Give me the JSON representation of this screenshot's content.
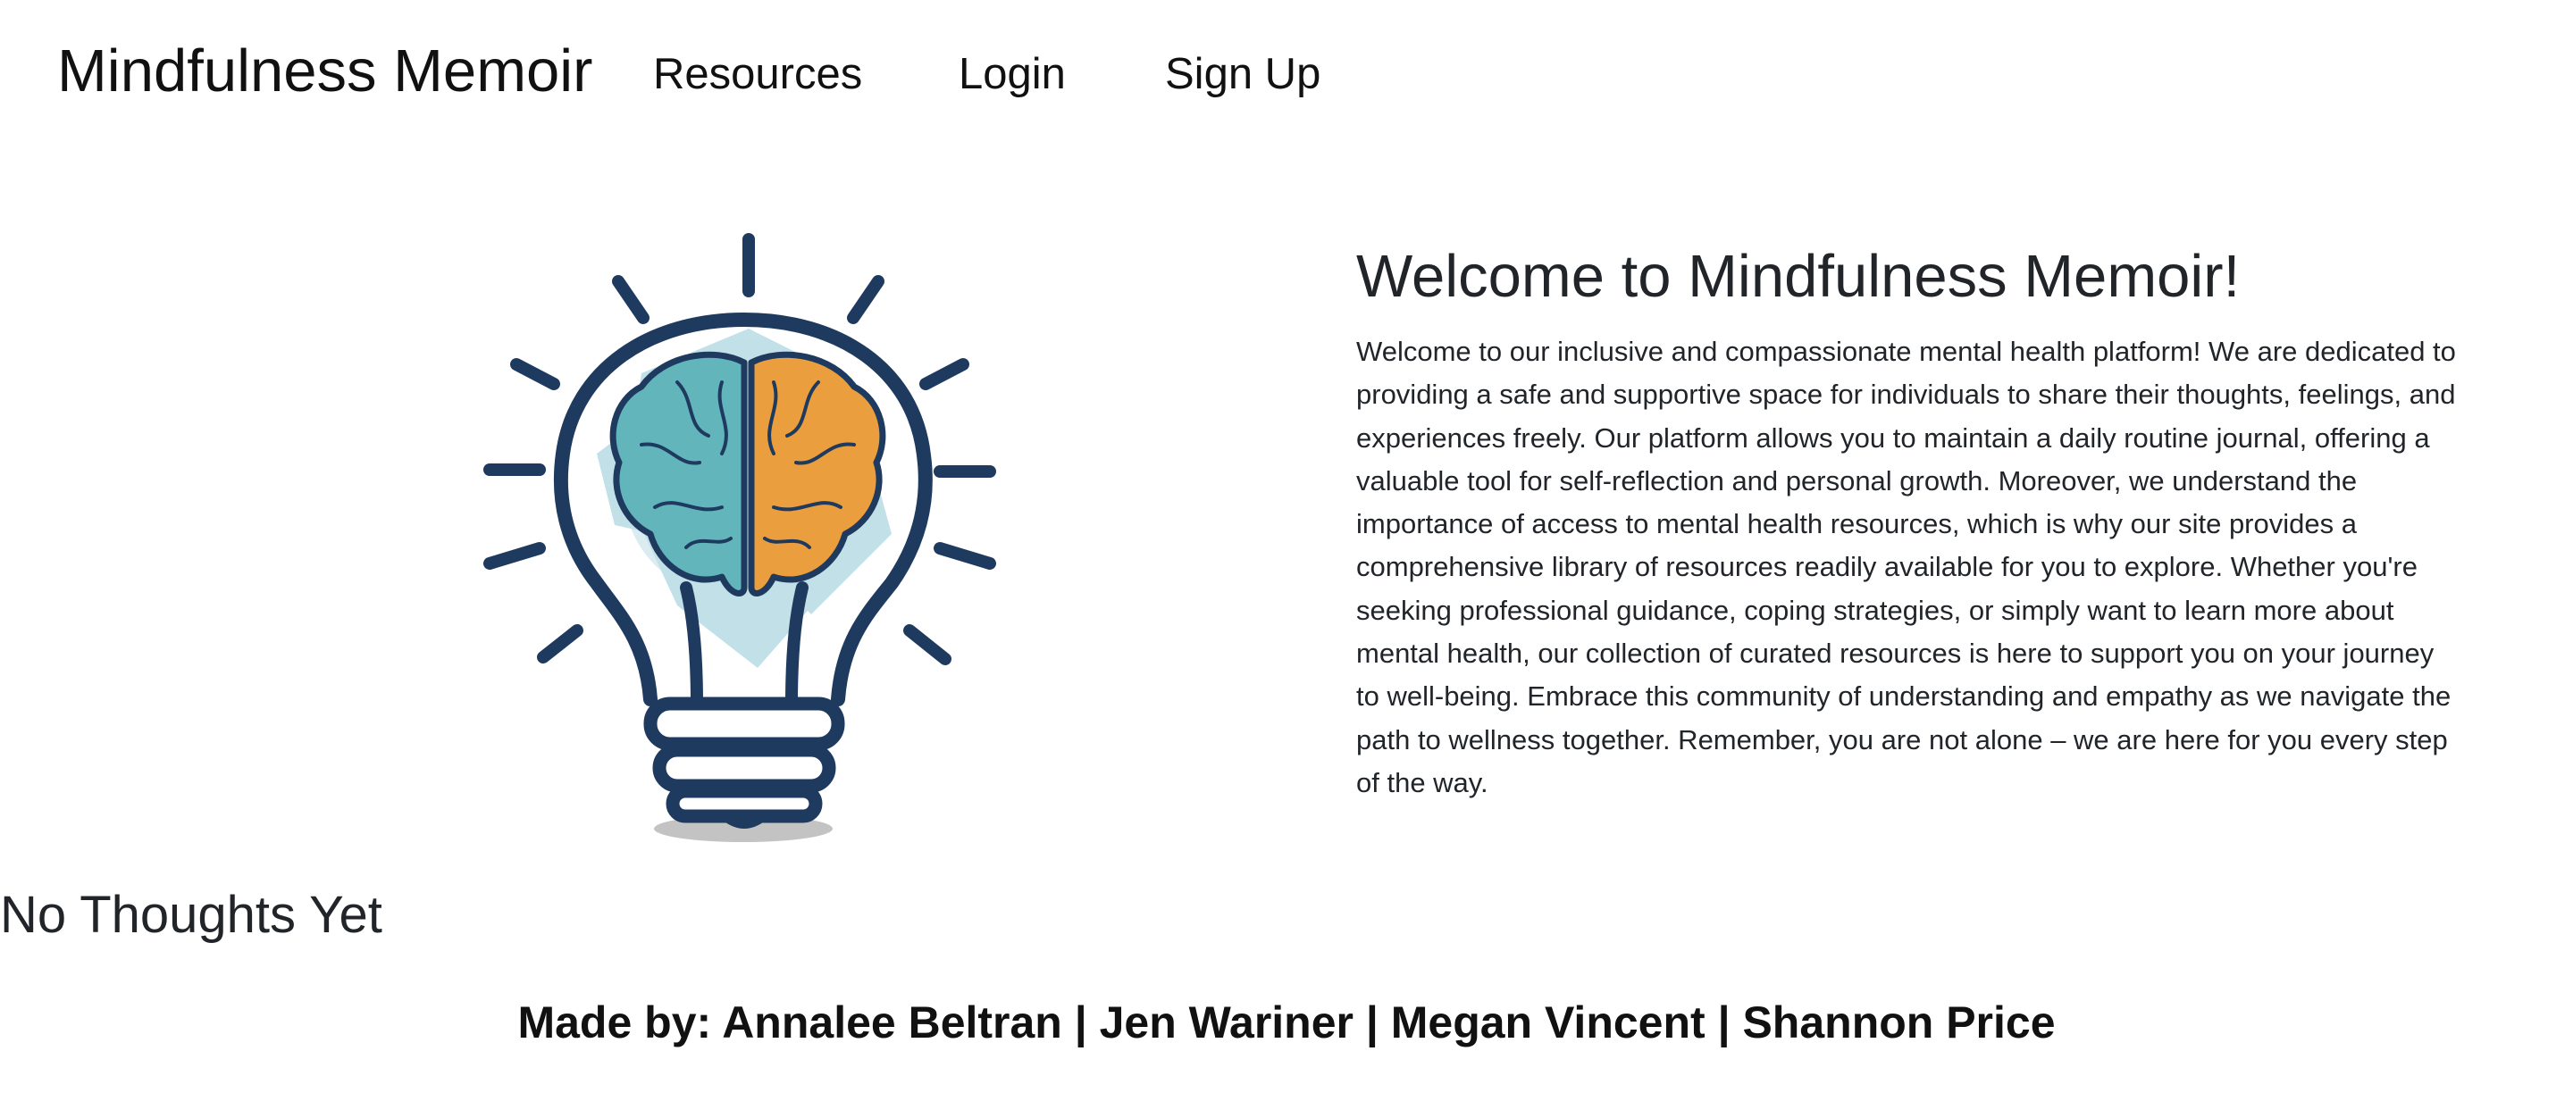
{
  "nav": {
    "brand": "Mindfulness Memoir",
    "links": [
      {
        "label": "Resources"
      },
      {
        "label": "Login"
      },
      {
        "label": "Sign Up"
      }
    ]
  },
  "hero": {
    "image_icon": "lightbulb-brain-icon",
    "title": "Welcome to Mindfulness Memoir!",
    "body": "Welcome to our inclusive and compassionate mental health platform! We are dedicated to providing a safe and supportive space for individuals to share their thoughts, feelings, and experiences freely. Our platform allows you to maintain a daily routine journal, offering a valuable tool for self-reflection and personal growth. Moreover, we understand the importance of access to mental health resources, which is why our site provides a comprehensive library of resources readily available for you to explore. Whether you're seeking professional guidance, coping strategies, or simply want to learn more about mental health, our collection of curated resources is here to support you on your journey to well-being. Embrace this community of understanding and empathy as we navigate the path to wellness together. Remember, you are not alone – we are here for you every step of the way."
  },
  "thoughts": {
    "empty_label": "No Thoughts Yet"
  },
  "footer": {
    "credits": "Made by: Annalee Beltran | Jen Wariner | Megan Vincent | Shannon Price"
  },
  "colors": {
    "navy": "#1f3a5f",
    "teal": "#62b6bb",
    "orange": "#eb9e3e",
    "glow": "#a8d4df"
  }
}
